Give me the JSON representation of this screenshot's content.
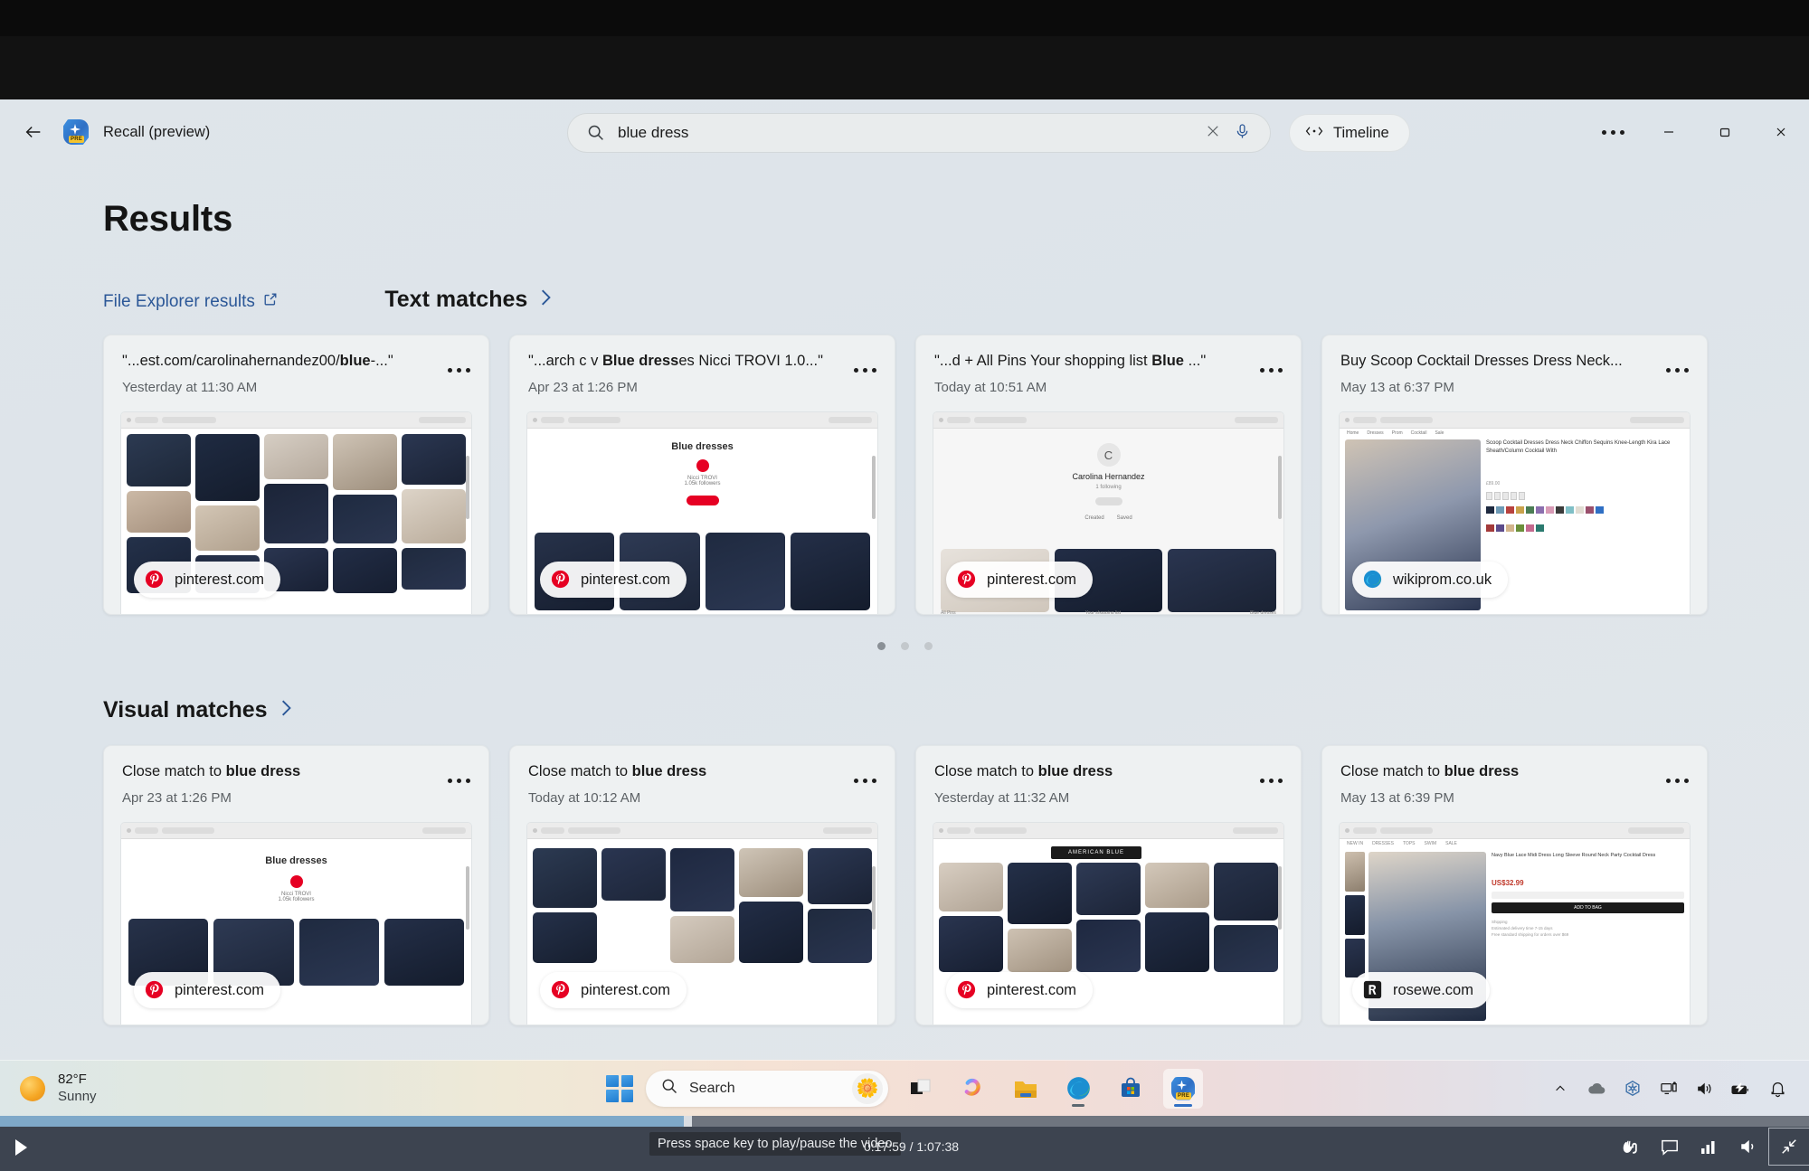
{
  "app": {
    "title": "Recall (preview)",
    "back_label": "Back",
    "more_label": "See more",
    "minimize_label": "Minimize",
    "maximize_label": "Maximize",
    "close_label": "Close"
  },
  "search": {
    "value": "blue dress",
    "placeholder": "Search",
    "clear_label": "Clear",
    "mic_label": "Search with voice"
  },
  "timeline": {
    "label": "Timeline"
  },
  "page": {
    "title": "Results",
    "file_explorer_link": "File Explorer results"
  },
  "sections": [
    {
      "id": "text-matches",
      "label": "Text matches",
      "cards": [
        {
          "title_prefix": "\"...est.com/carolinahernandez00/",
          "title_bold": "blue",
          "title_suffix": "-...\"",
          "time": "Yesterday at 11:30 AM",
          "source": "pinterest.com",
          "source_icon": "pinterest-icon"
        },
        {
          "title_prefix": "\"...arch c v ",
          "title_bold": "Blue dress",
          "title_suffix": "es Nicci TROVI 1.0...\"",
          "time": "Apr 23 at 1:26 PM",
          "source": "pinterest.com",
          "source_icon": "pinterest-icon"
        },
        {
          "title_prefix": "\"...d + All Pins Your shopping list ",
          "title_bold": "Blue",
          "title_suffix": " ...\"",
          "time": "Today at 10:51 AM",
          "source": "pinterest.com",
          "source_icon": "pinterest-icon"
        },
        {
          "title_prefix": "Buy Scoop Cocktail Dresses Dress Neck...",
          "title_bold": "",
          "title_suffix": "",
          "time": "May 13 at 6:37 PM",
          "source": "wikiprom.co.uk",
          "source_icon": "edge-icon"
        }
      ],
      "pager": {
        "count": 3,
        "active": 0
      }
    },
    {
      "id": "visual-matches",
      "label": "Visual matches",
      "cards": [
        {
          "title_prefix": "Close match to ",
          "title_bold": "blue dress",
          "title_suffix": "",
          "time": "Apr 23 at 1:26 PM",
          "source": "pinterest.com",
          "source_icon": "pinterest-icon"
        },
        {
          "title_prefix": "Close match to ",
          "title_bold": "blue dress",
          "title_suffix": "",
          "time": "Today at 10:12 AM",
          "source": "pinterest.com",
          "source_icon": "pinterest-icon"
        },
        {
          "title_prefix": "Close match to ",
          "title_bold": "blue dress",
          "title_suffix": "",
          "time": "Yesterday at 11:32 AM",
          "source": "pinterest.com",
          "source_icon": "pinterest-icon"
        },
        {
          "title_prefix": "Close match to ",
          "title_bold": "blue dress",
          "title_suffix": "",
          "time": "May 13 at 6:39 PM",
          "source": "rosewe.com",
          "source_icon": "rosewe-icon"
        }
      ]
    }
  ],
  "taskbar": {
    "weather_temp": "82°F",
    "weather_condition": "Sunny",
    "search_placeholder": "Search",
    "start_label": "Start",
    "items": [
      {
        "name": "task-view",
        "label": "Task View"
      },
      {
        "name": "copilot",
        "label": "Copilot"
      },
      {
        "name": "file-explorer",
        "label": "File Explorer"
      },
      {
        "name": "edge",
        "label": "Microsoft Edge"
      },
      {
        "name": "store",
        "label": "Microsoft Store"
      },
      {
        "name": "recall",
        "label": "Recall (preview)"
      }
    ],
    "tray": [
      {
        "name": "show-hidden-icons",
        "label": "Show hidden icons"
      },
      {
        "name": "onedrive",
        "label": "OneDrive"
      },
      {
        "name": "copilot-tray",
        "label": "Copilot"
      },
      {
        "name": "network",
        "label": "Network"
      },
      {
        "name": "volume",
        "label": "Volume"
      },
      {
        "name": "battery",
        "label": "Battery"
      },
      {
        "name": "notifications",
        "label": "Notifications"
      }
    ]
  },
  "player": {
    "tooltip": "Press space key to play/pause the video",
    "time": "0:17:59 / 1:07:38",
    "progress_percent": 38,
    "play_label": "Play",
    "controls": [
      {
        "name": "sign-language",
        "label": "Sign language"
      },
      {
        "name": "captions",
        "label": "Captions"
      },
      {
        "name": "quality",
        "label": "Quality"
      },
      {
        "name": "volume",
        "label": "Volume"
      },
      {
        "name": "exit-fullscreen",
        "label": "Exit full screen"
      }
    ]
  },
  "colors": {
    "accent": "#2b5797",
    "pinterest": "#e60023",
    "played_bar": "#7fa9c9",
    "desktop_bg": "#dfe5ea"
  }
}
